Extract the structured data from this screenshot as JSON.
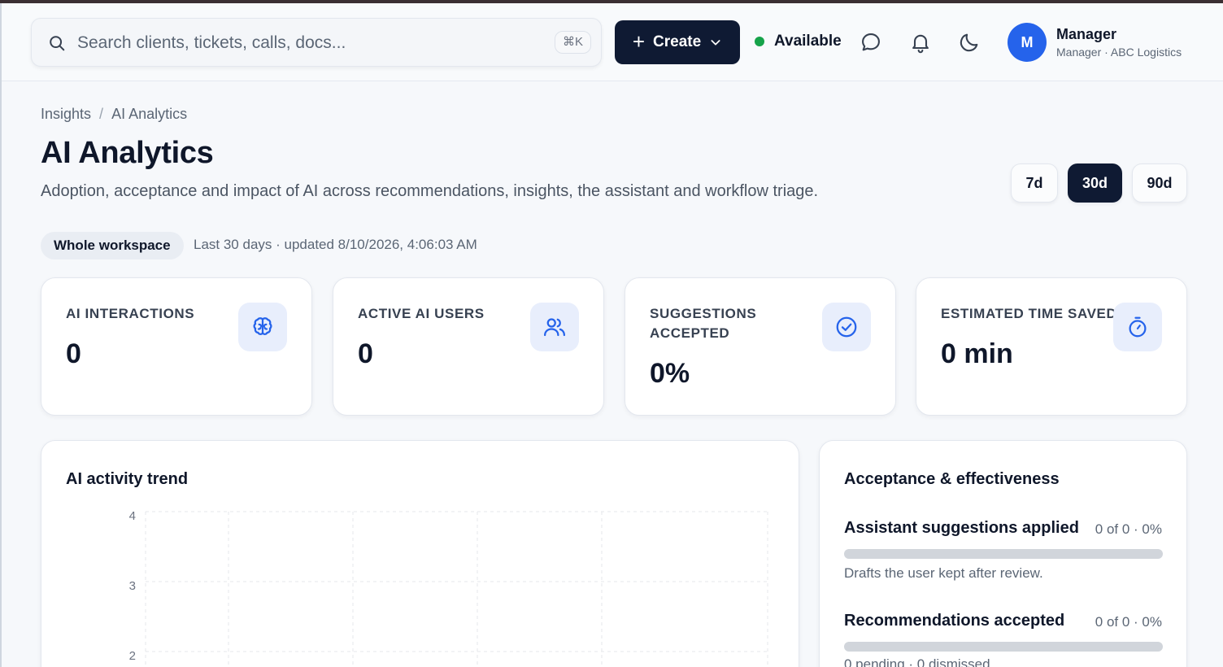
{
  "search": {
    "placeholder": "Search clients, tickets, calls, docs...",
    "shortcut": "⌘K"
  },
  "header": {
    "create_label": "Create",
    "status_label": "Available",
    "status_color": "#16a34a",
    "icons": [
      "chat-icon",
      "bell-icon",
      "moon-icon"
    ],
    "user": {
      "initial": "M",
      "name": "Manager",
      "role": "Manager · ABC Logistics"
    }
  },
  "breadcrumb": {
    "parent": "Insights",
    "current": "AI Analytics"
  },
  "page": {
    "title": "AI Analytics",
    "subtitle": "Adoption, acceptance and impact of AI across recommendations, insights, the assistant and workflow triage."
  },
  "range": {
    "options": [
      "7d",
      "30d",
      "90d"
    ],
    "selected": "30d"
  },
  "scope": {
    "chip": "Whole workspace",
    "meta": "Last 30 days · updated 8/10/2026, 4:06:03 AM"
  },
  "kpis": [
    {
      "label": "AI INTERACTIONS",
      "value": "0",
      "icon": "brain-icon"
    },
    {
      "label": "ACTIVE AI USERS",
      "value": "0",
      "icon": "users-icon"
    },
    {
      "label": "SUGGESTIONS ACCEPTED",
      "value": "0%",
      "icon": "check-circle-icon"
    },
    {
      "label": "ESTIMATED TIME SAVED",
      "value": "0 min",
      "icon": "stopwatch-icon"
    }
  ],
  "trend": {
    "title": "AI activity trend",
    "chart_data": {
      "type": "line",
      "title": "AI activity trend",
      "y_ticks": [
        "4",
        "3",
        "2"
      ],
      "grid": true
    }
  },
  "acceptance": {
    "title": "Acceptance & effectiveness",
    "metrics": [
      {
        "name": "Assistant suggestions applied",
        "value": "0 of 0 · 0%",
        "fraction": 0,
        "desc": "Drafts the user kept after review."
      },
      {
        "name": "Recommendations accepted",
        "value": "0 of 0 · 0%",
        "fraction": 0,
        "desc": "0 pending · 0 dismissed"
      }
    ]
  },
  "colors": {
    "accent": "#2563eb",
    "navy": "#0f1a33",
    "icon_bg": "#e8eefc"
  }
}
